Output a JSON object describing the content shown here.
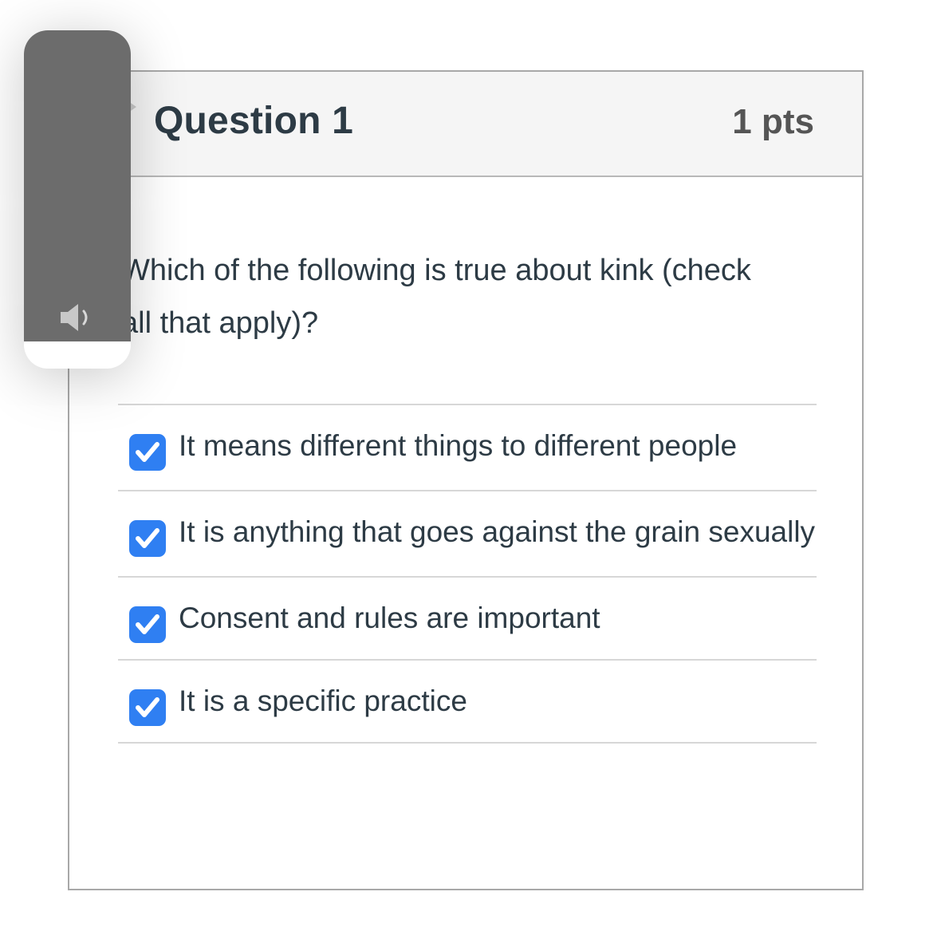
{
  "question": {
    "title": "Question 1",
    "points": "1 pts",
    "text": "Which of the following is true about kink (check all that apply)?",
    "answers": [
      {
        "label": "It means different things to different people",
        "checked": true
      },
      {
        "label": "It is anything that goes against the grain sexually",
        "checked": true
      },
      {
        "label": "Consent and rules are important",
        "checked": true
      },
      {
        "label": "It is a specific practice",
        "checked": true
      }
    ]
  },
  "overlay": {
    "icon": "speaker-icon"
  },
  "colors": {
    "checkbox": "#2f7ff2",
    "header_bg": "#f5f5f5",
    "overlay": "#6c6c6c"
  }
}
